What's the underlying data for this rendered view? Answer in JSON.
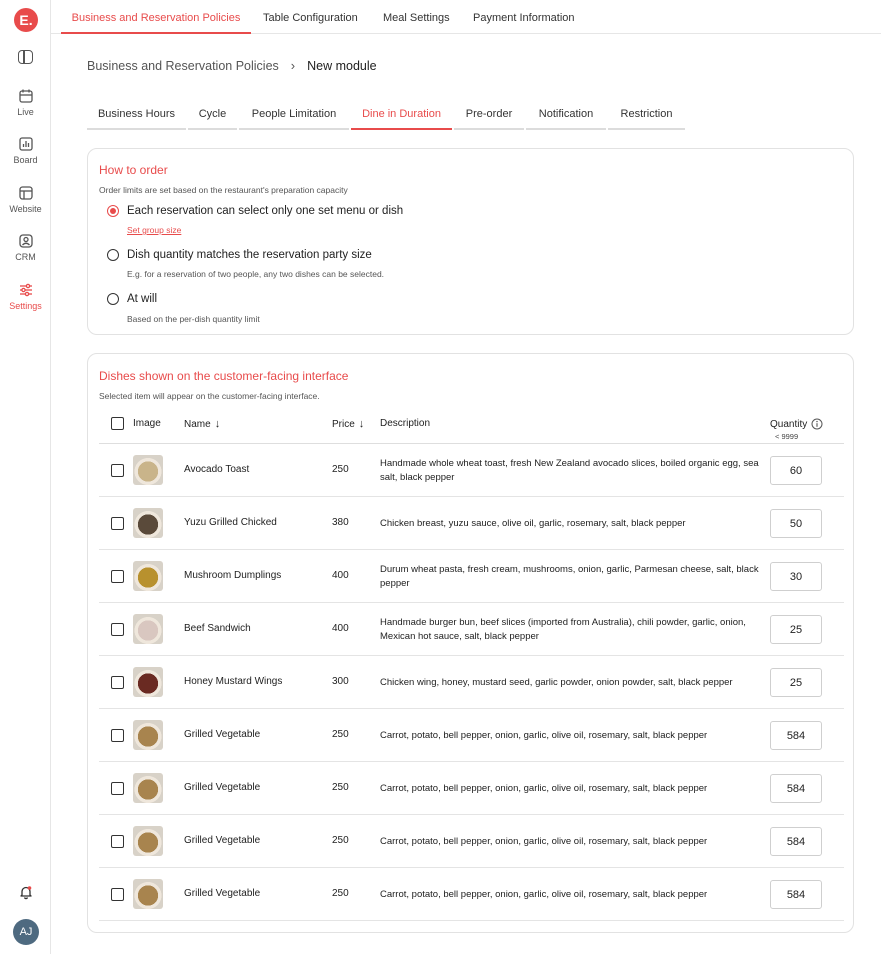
{
  "app": {
    "logo": "E."
  },
  "sidebar": {
    "items": [
      {
        "label": "Live",
        "icon": "calendar-icon"
      },
      {
        "label": "Board",
        "icon": "chart-icon"
      },
      {
        "label": "Website",
        "icon": "browser-icon"
      },
      {
        "label": "CRM",
        "icon": "contact-icon"
      },
      {
        "label": "Settings",
        "icon": "sliders-icon",
        "active": true
      }
    ],
    "avatar": "AJ"
  },
  "top_tabs": [
    "Business and Reservation Policies",
    "Table Configuration",
    "Meal Settings",
    "Payment Information"
  ],
  "breadcrumb": {
    "parent": "Business and Reservation Policies",
    "current": "New module"
  },
  "sub_tabs": [
    "Business Hours",
    "Cycle",
    "People Limitation",
    "Dine in Duration",
    "Pre-order",
    "Notification",
    "Restriction"
  ],
  "how_to_order": {
    "title": "How to order",
    "subtitle": "Order limits are set based on the restaurant's preparation capacity",
    "options": [
      {
        "label": "Each reservation can select only one set menu or dish",
        "link": "Set group size",
        "selected": true
      },
      {
        "label": "Dish quantity matches the reservation party size",
        "hint": "E.g. for a reservation of two people, any two dishes can be selected.",
        "selected": false
      },
      {
        "label": "At will",
        "hint": "Based on the per-dish quantity limit",
        "selected": false
      }
    ]
  },
  "dishes": {
    "title": "Dishes shown on the customer-facing interface",
    "subtitle": "Selected item will appear on the customer-facing interface.",
    "columns": {
      "image": "Image",
      "name": "Name",
      "price": "Price",
      "description": "Description",
      "quantity": "Quantity",
      "quantity_limit": "< 9999"
    },
    "rows": [
      {
        "name": "Avocado Toast",
        "price": "250",
        "description": "Handmade whole wheat toast, fresh New Zealand avocado slices, boiled organic egg, sea salt, black pepper",
        "quantity": "60",
        "thumb": "#c9b48a"
      },
      {
        "name": "Yuzu Grilled Chicked",
        "price": "380",
        "description": "Chicken breast, yuzu sauce, olive oil, garlic, rosemary, salt, black pepper",
        "quantity": "50",
        "thumb": "#5a4a3a"
      },
      {
        "name": "Mushroom Dumplings",
        "price": "400",
        "description": "Durum wheat pasta, fresh cream, mushrooms, onion, garlic, Parmesan cheese, salt, black pepper",
        "quantity": "30",
        "thumb": "#b8912e"
      },
      {
        "name": "Beef Sandwich",
        "price": "400",
        "description": "Handmade burger bun, beef slices (imported from Australia), chili powder, garlic, onion, Mexican hot sauce, salt, black pepper",
        "quantity": "25",
        "thumb": "#d9c7c0"
      },
      {
        "name": "Honey Mustard Wings",
        "price": "300",
        "description": "Chicken wing, honey, mustard seed, garlic powder, onion powder, salt, black pepper",
        "quantity": "25",
        "thumb": "#6a2a22"
      },
      {
        "name": "Grilled Vegetable",
        "price": "250",
        "description": "Carrot, potato, bell pepper, onion, garlic, olive oil, rosemary, salt, black pepper",
        "quantity": "584",
        "thumb": "#a8844e"
      },
      {
        "name": "Grilled Vegetable",
        "price": "250",
        "description": "Carrot, potato, bell pepper, onion, garlic, olive oil, rosemary, salt, black pepper",
        "quantity": "584",
        "thumb": "#a8844e"
      },
      {
        "name": "Grilled Vegetable",
        "price": "250",
        "description": "Carrot, potato, bell pepper, onion, garlic, olive oil, rosemary, salt, black pepper",
        "quantity": "584",
        "thumb": "#a8844e"
      },
      {
        "name": "Grilled Vegetable",
        "price": "250",
        "description": "Carrot, potato, bell pepper, onion, garlic, olive oil, rosemary, salt, black pepper",
        "quantity": "584",
        "thumb": "#a8844e"
      }
    ]
  },
  "colors": {
    "accent": "#e84b4b",
    "border": "#e2e2e2"
  }
}
